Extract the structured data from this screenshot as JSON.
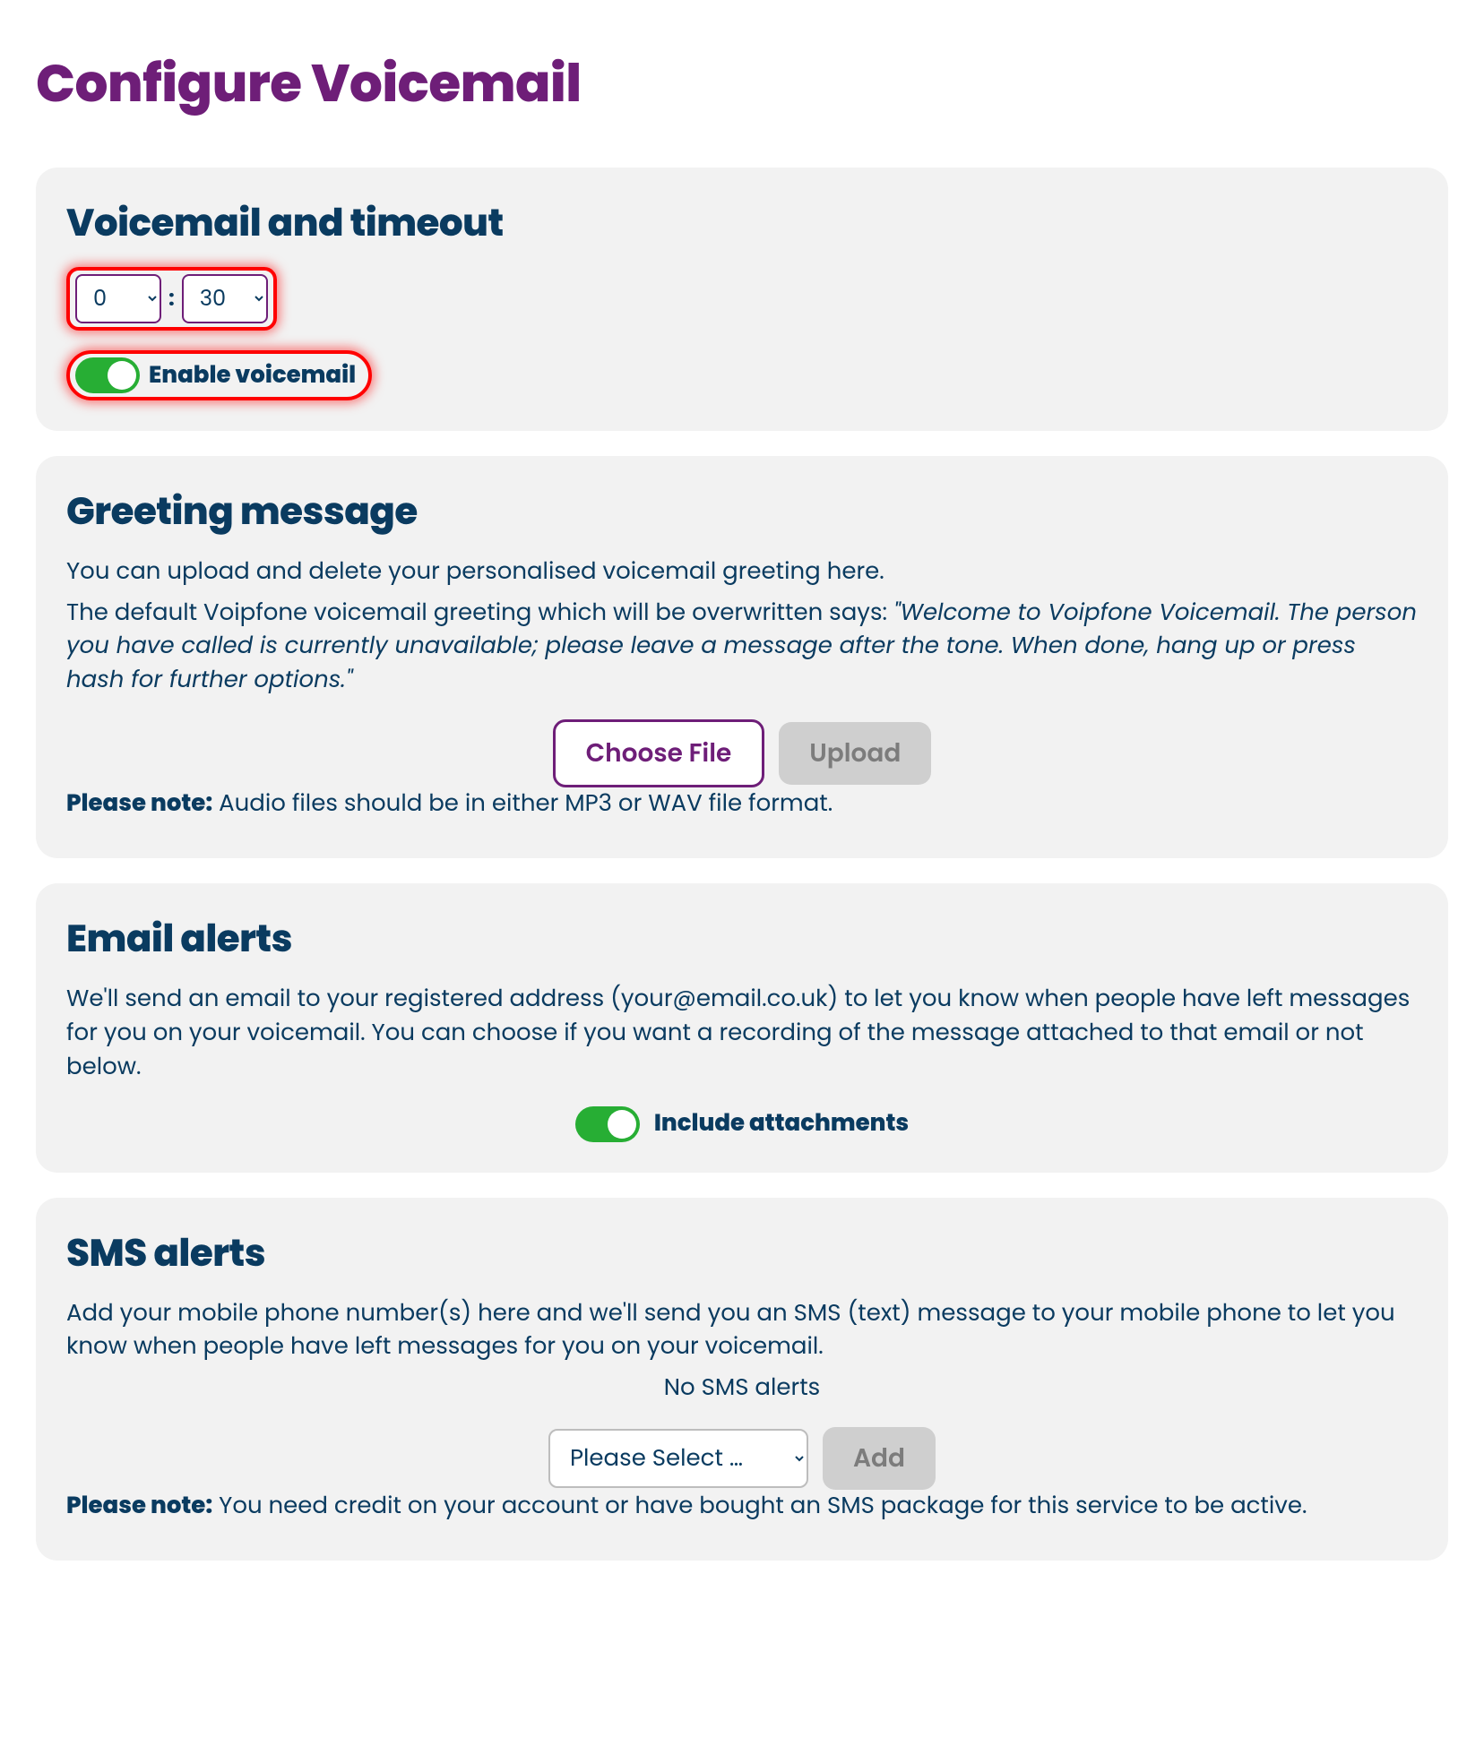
{
  "page_title": "Configure Voicemail",
  "timeout": {
    "heading": "Voicemail and timeout",
    "minutes": "0",
    "seconds": "30",
    "colon": ":",
    "enable_label": "Enable voicemail",
    "enabled": true
  },
  "greeting": {
    "heading": "Greeting message",
    "intro_line1": "You can upload and delete your personalised voicemail greeting here.",
    "intro_line2_prefix": "The default Voipfone voicemail greeting which will be overwritten says: ",
    "default_quote": "\"Welcome to Voipfone Voicemail. The person you have called is currently unavailable; please leave a message after the tone. When done, hang up or press hash for further options.\"",
    "choose_file_label": "Choose File",
    "upload_label": "Upload",
    "note_label": "Please note:",
    "note_text": " Audio files should be in either MP3 or WAV file format."
  },
  "email": {
    "heading": "Email alerts",
    "body": "We'll send an email to your registered address (your@email.co.uk) to let you know when people have left messages for you on your voicemail. You can choose if you want a recording of the message attached to that email or not below.",
    "toggle_label": "Include attachments",
    "attachments_enabled": true
  },
  "sms": {
    "heading": "SMS alerts",
    "body": "Add your mobile phone number(s) here and we'll send you an SMS (text) message to your mobile phone to let you know when people have left messages for you on your voicemail.",
    "empty_state": "No SMS alerts",
    "select_placeholder": "Please Select …",
    "add_label": "Add",
    "note_label": "Please note:",
    "note_text": " You need credit on your account or have bought an SMS package for this service to be active."
  }
}
